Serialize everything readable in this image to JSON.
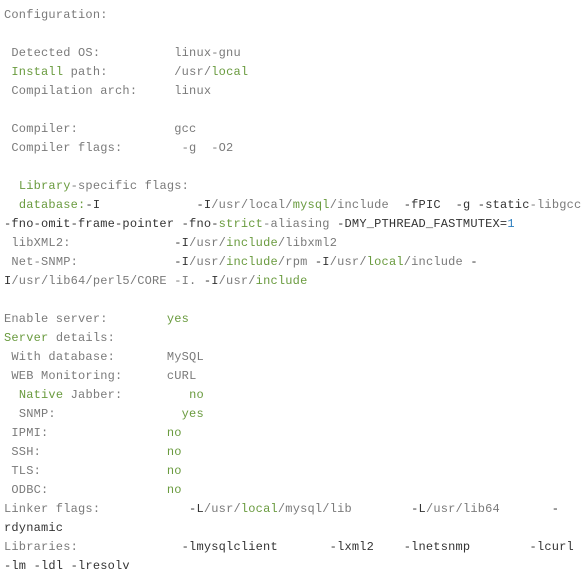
{
  "header": "Configuration:",
  "rows": [
    {
      "label": " Detected OS:",
      "value": "linux-gnu"
    },
    {
      "label2": [
        "Install",
        " path:"
      ],
      "value": "/usr/local",
      "value_parts": [
        "/usr/",
        "local"
      ]
    },
    {
      "label": " Compilation arch:",
      "value": "linux"
    }
  ],
  "compiler": {
    "label": " Compiler:",
    "value": "gcc"
  },
  "compiler_flags": {
    "label": " Compiler flags:",
    "value": " -g  -O2"
  },
  "libspec": {
    "pre": "  ",
    "kw": "Library",
    "rest": "-specific flags:"
  },
  "database": {
    "label": "  database:",
    "line": "             -I/usr/local/mysql/include  -fPIC  -g -static-libgcc -fno-omit-frame-pointer -fno-strict-aliasing -DMY_PTHREAD_FASTMUTEX=1",
    "tok": {
      "I": "-I",
      "usrlocal": "/usr/local/",
      "mysql": "mysql",
      "incl": "/include",
      "fpic": "-fPIC",
      "g": "-g",
      "static": "-static",
      "libgcc": "-libgcc",
      "omit": "-fno-omit-frame-pointer",
      "fno": "-fno-",
      "strict": "strict",
      "alias": "-aliasing",
      "dmy": "-DMY_PTHREAD_FASTMUTEX=",
      "one": "1"
    }
  },
  "libxml2": {
    "label": " libXML2:",
    "indent": "             ",
    "tok": {
      "I": "-I",
      "pusr": "/usr/",
      "kinc": "include",
      "plib": "/libxml2"
    }
  },
  "netsnmp": {
    "label": " Net-SNMP:",
    "indent": "             ",
    "tok": {
      "I": "-I",
      "pusr": "/usr/",
      "kinc": "include",
      "prpm": "/rpm ",
      "pusr2": "/usr/",
      "klocal": "local",
      "pincl": "/include ",
      "plib64": "/usr/lib64/perl5/CORE -I. "
    }
  },
  "enable_server": {
    "label": "Enable server:",
    "value": "yes"
  },
  "server_details": {
    "kw": "Server",
    "rest": " details:"
  },
  "with_db": {
    "label": " With database:",
    "value": "MySQL"
  },
  "web_mon": {
    "label": " WEB Monitoring:",
    "value": "cURL"
  },
  "native": {
    "pre": "  ",
    "kw": "Native",
    "rest": " Jabber:",
    "value": "no"
  },
  "snmp": {
    "label": "  SNMP:",
    "value": "yes"
  },
  "ipmi": {
    "label": " IPMI:",
    "value": "no"
  },
  "ssh": {
    "label": " SSH:",
    "value": "no"
  },
  "tls": {
    "label": " TLS:",
    "value": "no"
  },
  "odbc": {
    "label": " ODBC:",
    "value": "no"
  },
  "linker": {
    "label": "Linker flags:",
    "indent": "            ",
    "tok": {
      "L": "-L",
      "pusr": "/usr/",
      "klocal": "local",
      "pmysql": "/mysql/lib",
      "sp": "        ",
      "pusr2": "/usr/",
      "plib64": "lib64",
      "sp2": "       ",
      "rdyn": "-rdynamic"
    }
  },
  "libraries": {
    "label": "Libraries:",
    "indent": "              ",
    "tok": {
      "mc": "-lmysqlclient",
      "sp": "       ",
      "xml": "-lxml2",
      "sp2": "    ",
      "ns": "-lnetsnmp",
      "sp3": "        ",
      "tail": "-lcurl -lm -ldl -lresolv"
    }
  }
}
